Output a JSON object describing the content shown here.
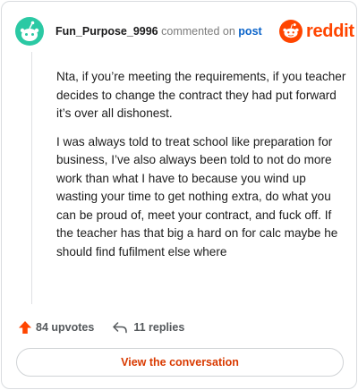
{
  "header": {
    "username": "Fun_Purpose_9996",
    "commented_on": "commented on",
    "post_link": "post",
    "logo_text": "reddit",
    "brand_color": "#ff4500",
    "avatar_color": "#2bc9a4",
    "avatar_icon": "snoo-avatar-icon"
  },
  "comment": {
    "paragraphs": [
      "Nta, if you’re meeting the requirements, if you teacher decides to change the contract they had put forward it’s over all dishonest.",
      "I was always told to treat school like preparation for business, I’ve also always been told to not do more work than what I have to because you wind up wasting your time to get nothing extra, do what you can be proud of, meet your contract, and fuck off. If the teacher has that big a hard on for calc maybe he should find fufilment else where"
    ]
  },
  "actions": {
    "upvotes_label": "84 upvotes",
    "replies_label": "11 replies",
    "upvote_icon": "upvote-arrow-icon",
    "reply_icon": "reply-arrow-icon",
    "upvote_color": "#ff4500"
  },
  "cta": {
    "label": "View the conversation",
    "color": "#d93a00"
  }
}
